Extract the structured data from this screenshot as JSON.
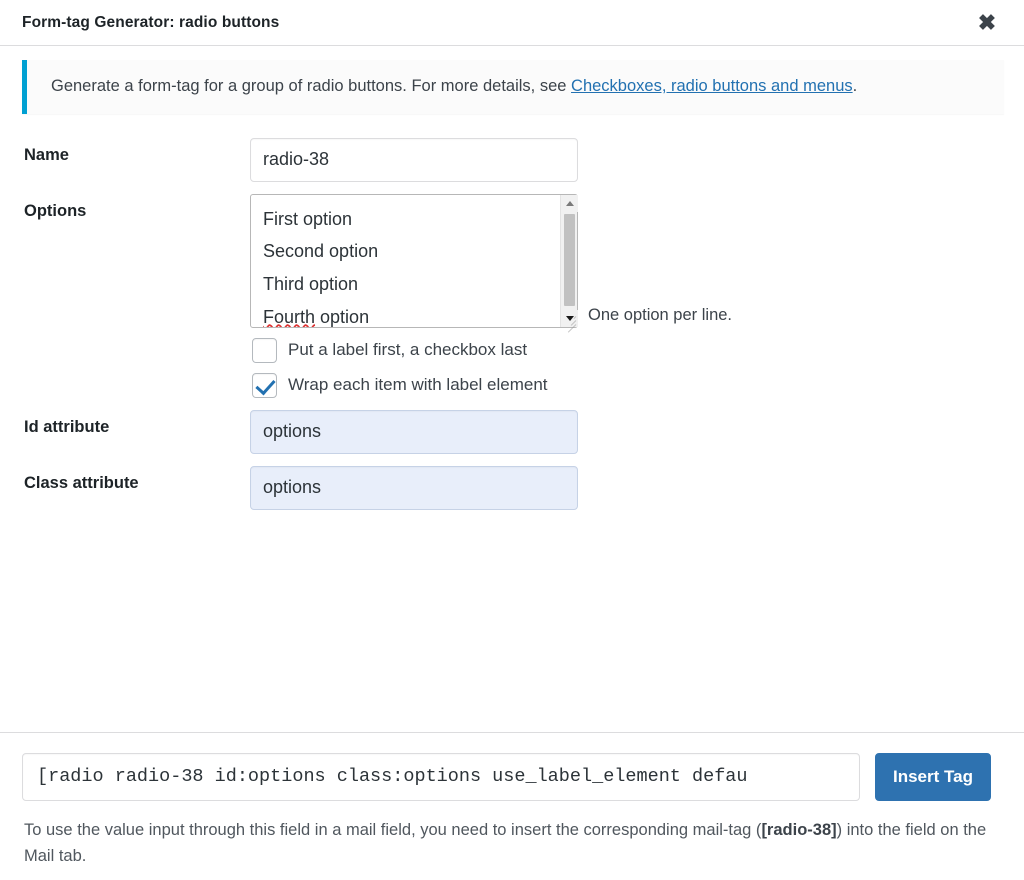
{
  "header": {
    "title": "Form-tag Generator: radio buttons",
    "close_label": "✖"
  },
  "notice": {
    "text_before": "Generate a form-tag for a group of radio buttons. For more details, see ",
    "link_text": "Checkboxes, radio buttons and menus",
    "text_after": ".",
    "accent_color": "#00a0d2"
  },
  "fields": {
    "name": {
      "label": "Name",
      "value": "radio-38",
      "placeholder": ""
    },
    "options": {
      "label": "Options",
      "lines": [
        "First option",
        "Second option",
        "Third option",
        "Fourth option"
      ],
      "misspelled_word": "Fourth",
      "misspelled_rest": " option",
      "hint": "One option per line."
    },
    "id_attribute": {
      "label": "Id attribute",
      "value": "options"
    },
    "class_attribute": {
      "label": "Class attribute",
      "value": "options"
    }
  },
  "checkboxes": [
    {
      "label": "Put a label first, a checkbox last",
      "checked": false
    },
    {
      "label": "Wrap each item with label element",
      "checked": true
    }
  ],
  "footer": {
    "tag_value": "[radio radio-38 id:options class:options use_label_element defau",
    "insert_button": "Insert Tag",
    "note_part1": "To use the value input through this field in a mail field, you need to insert the corresponding mail-tag (",
    "note_tag": "[radio-38]",
    "note_part2": ") into the field on the Mail tab."
  },
  "colors": {
    "primary_button": "#2e72b0",
    "link": "#2271b1",
    "notice_border": "#00a0d2",
    "autofill_bg": "#e8eefa"
  }
}
